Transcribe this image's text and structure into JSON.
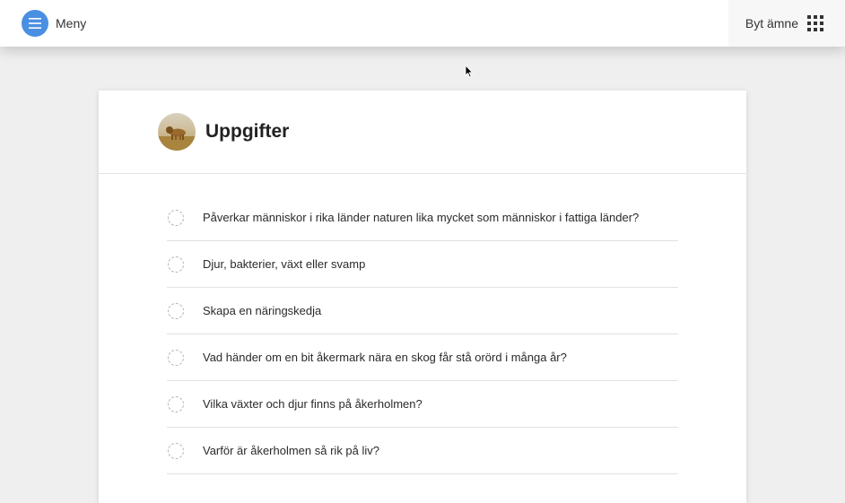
{
  "topbar": {
    "menu_label": "Meny",
    "menu_icon": "hamburger-icon",
    "subject_label": "Byt ämne",
    "subject_icon": "grid-icon"
  },
  "colors": {
    "menu_accent": "#4a90e2",
    "background": "#efefef"
  },
  "card": {
    "title": "Uppgifter",
    "avatar": "lion-photo",
    "tasks": [
      {
        "label": "Påverkar människor i rika länder naturen lika mycket som människor i fattiga länder?"
      },
      {
        "label": "Djur, bakterier, växt eller svamp"
      },
      {
        "label": "Skapa en näringskedja"
      },
      {
        "label": "Vad händer om en bit åkermark nära en skog får stå orörd i många år?"
      },
      {
        "label": "Vilka växter och djur finns på åkerholmen?"
      },
      {
        "label": "Varför är åkerholmen så rik på liv?"
      }
    ]
  }
}
